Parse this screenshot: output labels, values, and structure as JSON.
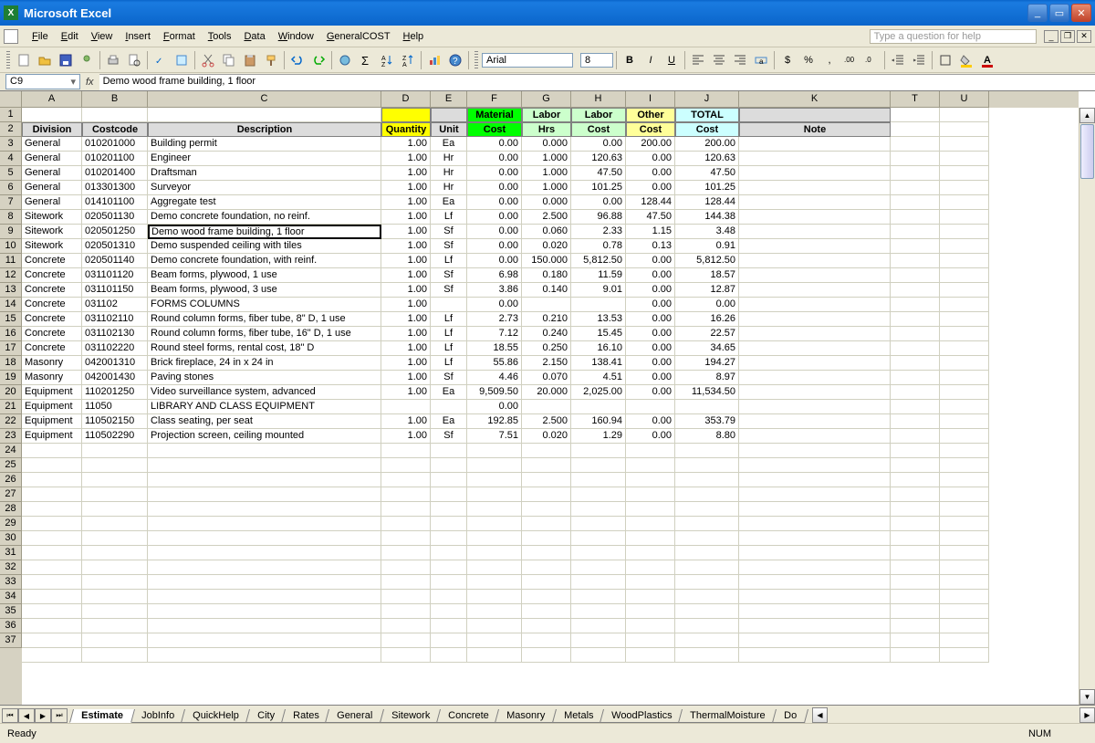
{
  "titlebar": {
    "title": "Microsoft Excel"
  },
  "menu": {
    "items": [
      "File",
      "Edit",
      "View",
      "Insert",
      "Format",
      "Tools",
      "Data",
      "Window",
      "GeneralCOST",
      "Help"
    ],
    "help_placeholder": "Type a question for help"
  },
  "toolbar": {
    "font": "Arial",
    "size": "8"
  },
  "formula": {
    "namebox": "C9",
    "fx": "fx",
    "value": "Demo wood frame building, 1 floor"
  },
  "columns": {
    "letters": [
      "A",
      "B",
      "C",
      "D",
      "E",
      "F",
      "G",
      "H",
      "I",
      "J",
      "K",
      "T",
      "U"
    ],
    "widths": [
      66,
      72,
      256,
      54,
      40,
      60,
      54,
      60,
      54,
      70,
      166,
      54,
      54
    ]
  },
  "row_count": 37,
  "header_row1": [
    "",
    "",
    "",
    "",
    "",
    "Material",
    "Labor",
    "Labor",
    "Other",
    "TOTAL",
    ""
  ],
  "header_row2": [
    "Division",
    "Costcode",
    "Description",
    "Quantity",
    "Unit",
    "Cost",
    "Hrs",
    "Cost",
    "Cost",
    "Cost",
    "Note"
  ],
  "data_rows": [
    {
      "division": "General",
      "costcode": "010201000",
      "desc": "Building permit",
      "qty": "1.00",
      "unit": "Ea",
      "mat": "0.00",
      "hrs": "0.000",
      "lcost": "0.00",
      "other": "200.00",
      "total": "200.00"
    },
    {
      "division": "General",
      "costcode": "010201100",
      "desc": "Engineer",
      "qty": "1.00",
      "unit": "Hr",
      "mat": "0.00",
      "hrs": "1.000",
      "lcost": "120.63",
      "other": "0.00",
      "total": "120.63"
    },
    {
      "division": "General",
      "costcode": "010201400",
      "desc": "Draftsman",
      "qty": "1.00",
      "unit": "Hr",
      "mat": "0.00",
      "hrs": "1.000",
      "lcost": "47.50",
      "other": "0.00",
      "total": "47.50"
    },
    {
      "division": "General",
      "costcode": "013301300",
      "desc": "Surveyor",
      "qty": "1.00",
      "unit": "Hr",
      "mat": "0.00",
      "hrs": "1.000",
      "lcost": "101.25",
      "other": "0.00",
      "total": "101.25"
    },
    {
      "division": "General",
      "costcode": "014101100",
      "desc": "Aggregate test",
      "qty": "1.00",
      "unit": "Ea",
      "mat": "0.00",
      "hrs": "0.000",
      "lcost": "0.00",
      "other": "128.44",
      "total": "128.44"
    },
    {
      "division": "Sitework",
      "costcode": "020501130",
      "desc": "Demo concrete foundation, no reinf.",
      "qty": "1.00",
      "unit": "Lf",
      "mat": "0.00",
      "hrs": "2.500",
      "lcost": "96.88",
      "other": "47.50",
      "total": "144.38"
    },
    {
      "division": "Sitework",
      "costcode": "020501250",
      "desc": "Demo wood frame building, 1 floor",
      "qty": "1.00",
      "unit": "Sf",
      "mat": "0.00",
      "hrs": "0.060",
      "lcost": "2.33",
      "other": "1.15",
      "total": "3.48"
    },
    {
      "division": "Sitework",
      "costcode": "020501310",
      "desc": "Demo suspended ceiling with tiles",
      "qty": "1.00",
      "unit": "Sf",
      "mat": "0.00",
      "hrs": "0.020",
      "lcost": "0.78",
      "other": "0.13",
      "total": "0.91"
    },
    {
      "division": "Concrete",
      "costcode": "020501140",
      "desc": "Demo concrete foundation, with reinf.",
      "qty": "1.00",
      "unit": "Lf",
      "mat": "0.00",
      "hrs": "150.000",
      "lcost": "5,812.50",
      "other": "0.00",
      "total": "5,812.50"
    },
    {
      "division": "Concrete",
      "costcode": "031101120",
      "desc": "Beam forms, plywood, 1 use",
      "qty": "1.00",
      "unit": "Sf",
      "mat": "6.98",
      "hrs": "0.180",
      "lcost": "11.59",
      "other": "0.00",
      "total": "18.57"
    },
    {
      "division": "Concrete",
      "costcode": "031101150",
      "desc": "Beam forms, plywood, 3 use",
      "qty": "1.00",
      "unit": "Sf",
      "mat": "3.86",
      "hrs": "0.140",
      "lcost": "9.01",
      "other": "0.00",
      "total": "12.87"
    },
    {
      "division": "Concrete",
      "costcode": "031102",
      "desc": "FORMS COLUMNS",
      "qty": "1.00",
      "unit": "",
      "mat": "0.00",
      "hrs": "",
      "lcost": "",
      "other": "0.00",
      "total": "0.00"
    },
    {
      "division": "Concrete",
      "costcode": "031102110",
      "desc": "Round column forms, fiber tube, 8\" D, 1 use",
      "qty": "1.00",
      "unit": "Lf",
      "mat": "2.73",
      "hrs": "0.210",
      "lcost": "13.53",
      "other": "0.00",
      "total": "16.26"
    },
    {
      "division": "Concrete",
      "costcode": "031102130",
      "desc": "Round column forms, fiber tube, 16\" D, 1 use",
      "qty": "1.00",
      "unit": "Lf",
      "mat": "7.12",
      "hrs": "0.240",
      "lcost": "15.45",
      "other": "0.00",
      "total": "22.57"
    },
    {
      "division": "Concrete",
      "costcode": "031102220",
      "desc": "Round steel forms, rental cost, 18\" D",
      "qty": "1.00",
      "unit": "Lf",
      "mat": "18.55",
      "hrs": "0.250",
      "lcost": "16.10",
      "other": "0.00",
      "total": "34.65"
    },
    {
      "division": "Masonry",
      "costcode": "042001310",
      "desc": "Brick fireplace, 24 in x 24 in",
      "qty": "1.00",
      "unit": "Lf",
      "mat": "55.86",
      "hrs": "2.150",
      "lcost": "138.41",
      "other": "0.00",
      "total": "194.27"
    },
    {
      "division": "Masonry",
      "costcode": "042001430",
      "desc": "Paving stones",
      "qty": "1.00",
      "unit": "Sf",
      "mat": "4.46",
      "hrs": "0.070",
      "lcost": "4.51",
      "other": "0.00",
      "total": "8.97"
    },
    {
      "division": "Equipment",
      "costcode": "110201250",
      "desc": "Video surveillance system, advanced",
      "qty": "1.00",
      "unit": "Ea",
      "mat": "9,509.50",
      "hrs": "20.000",
      "lcost": "2,025.00",
      "other": "0.00",
      "total": "11,534.50"
    },
    {
      "division": "Equipment",
      "costcode": "11050",
      "desc": "LIBRARY AND CLASS EQUIPMENT",
      "qty": "",
      "unit": "",
      "mat": "0.00",
      "hrs": "",
      "lcost": "",
      "other": "",
      "total": ""
    },
    {
      "division": "Equipment",
      "costcode": "110502150",
      "desc": "Class seating, per seat",
      "qty": "1.00",
      "unit": "Ea",
      "mat": "192.85",
      "hrs": "2.500",
      "lcost": "160.94",
      "other": "0.00",
      "total": "353.79"
    },
    {
      "division": "Equipment",
      "costcode": "110502290",
      "desc": "Projection screen, ceiling mounted",
      "qty": "1.00",
      "unit": "Sf",
      "mat": "7.51",
      "hrs": "0.020",
      "lcost": "1.29",
      "other": "0.00",
      "total": "8.80"
    }
  ],
  "tabs": [
    "Estimate",
    "JobInfo",
    "QuickHelp",
    "City",
    "Rates",
    "General",
    "Sitework",
    "Concrete",
    "Masonry",
    "Metals",
    "WoodPlastics",
    "ThermalMoisture",
    "Do"
  ],
  "active_tab": 0,
  "status": {
    "ready": "Ready",
    "num": "NUM"
  }
}
